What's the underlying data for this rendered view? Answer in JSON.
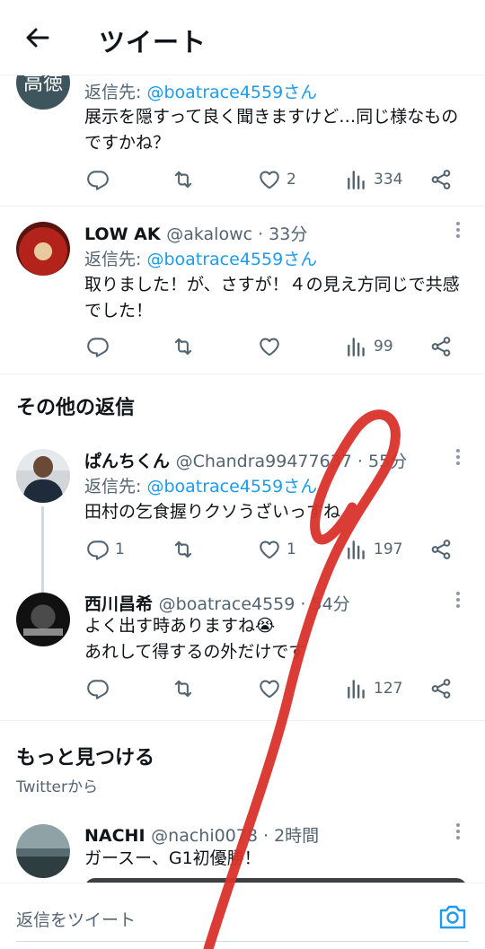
{
  "header": {
    "title": "ツイート"
  },
  "tweets": [
    {
      "avatar_text": "高徳",
      "reply_prefix": "返信先: ",
      "reply_to": "@boatrace4559さん",
      "text": "展示を隠すって良く聞きますけど…同じ様なものですかね？",
      "likes": "2",
      "views": "334"
    },
    {
      "name": "LOW AK",
      "handle": "@akalowc · 33分",
      "reply_prefix": "返信先: ",
      "reply_to": "@boatrace4559さん",
      "text": "取りました！が、さすが！４の見え方同じで共感でした！",
      "views": "99"
    }
  ],
  "other_replies": {
    "title": "その他の返信",
    "tweets": [
      {
        "name": "ぱんちくん",
        "handle": "@Chandra99477637 · 55分",
        "reply_prefix": "返信先: ",
        "reply_to": "@boatrace4559さん",
        "text": "田村の乞食握りクソうざいっすね",
        "replies": "1",
        "likes": "1",
        "views": "197"
      },
      {
        "name": "西川昌希",
        "handle": "@boatrace4559 · 54分",
        "line1": "よく出す時ありますね😭",
        "line2": "あれして得するの外だけです",
        "views": "127"
      }
    ]
  },
  "discover": {
    "title": "もっと見つける",
    "subtitle": "Twitterから",
    "tweet": {
      "name": "NACHI",
      "handle": "@nachi0078 · 2時間",
      "text": "ガースー、G1初優勝！"
    }
  },
  "composer": {
    "placeholder": "返信をツイート"
  },
  "colors": {
    "link": "#1d9bf0",
    "muted": "#536471",
    "scribble": "#d9322b"
  }
}
